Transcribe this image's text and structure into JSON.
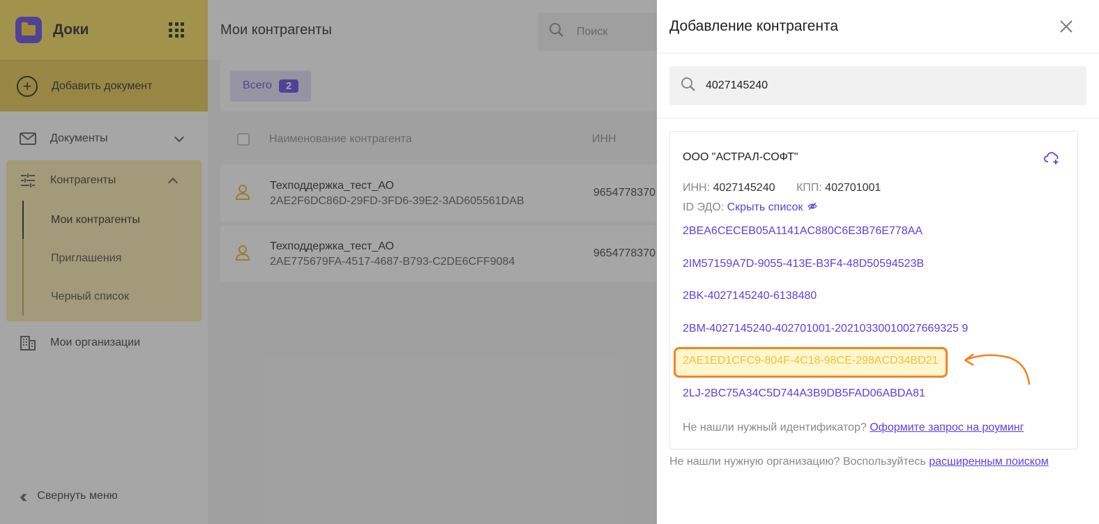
{
  "app": {
    "name": "Доки",
    "add_document": "Добавить документ",
    "collapse_menu": "Свернуть меню"
  },
  "sidebar": {
    "items": [
      {
        "label": "Документы"
      },
      {
        "label": "Контрагенты"
      },
      {
        "label": "Мои организации"
      }
    ],
    "sub_items": [
      {
        "label": "Мои контрагенты"
      },
      {
        "label": "Приглашения"
      },
      {
        "label": "Черный список"
      }
    ]
  },
  "main": {
    "title": "Мои контрагенты",
    "search_placeholder": "Поиск",
    "filter_label": "Всего",
    "filter_count": "2",
    "columns": {
      "name": "Наименование контрагента",
      "inn": "ИНН"
    },
    "rows": [
      {
        "name": "Техподдержка_тест_АО",
        "id": "2AE2F6DC86D-29FD-3FD6-39E2-3AD605561DAB",
        "inn": "9654778370"
      },
      {
        "name": "Техподдержка_тест_АО",
        "id": "2AE775679FA-4517-4687-B793-C2DE6CFF9084",
        "inn": "9654778370"
      }
    ]
  },
  "drawer": {
    "title": "Добавление контрагента",
    "search_value": "4027145240",
    "org": {
      "name": "ООО \"АСТРАЛ-СОФТ\"",
      "inn_label": "ИНН:",
      "inn": "4027145240",
      "kpp_label": "КПП:",
      "kpp": "402701001",
      "edo_label": "ID ЭДО:",
      "hide_list": "Скрыть список",
      "edo_ids": [
        "2BEA6CECEB05A1141AC880C6E3B76E778AA",
        "2IM57159A7D-9055-413E-B3F4-48D50594523B",
        "2BK-4027145240-6138480",
        "2BM-4027145240-402701001-20210330010027669325 9",
        "2AE1ED1CFC9-804F-4C18-98CE-298ACD34BD21",
        "2LJ-2BC75A34C5D744A3B9DB5FAD06ABDA81"
      ],
      "roaming_text": "Не нашли нужный идентификатор?",
      "roaming_link": "Оформите запрос на роуминг"
    },
    "not_found_text": "Не нашли нужную организацию? Воспользуйтесь",
    "not_found_link": "расширенным поиском"
  },
  "colors": {
    "brand_yellow": "#f6da53",
    "accent_purple": "#5b3fe4",
    "highlight_orange": "#f58220"
  }
}
